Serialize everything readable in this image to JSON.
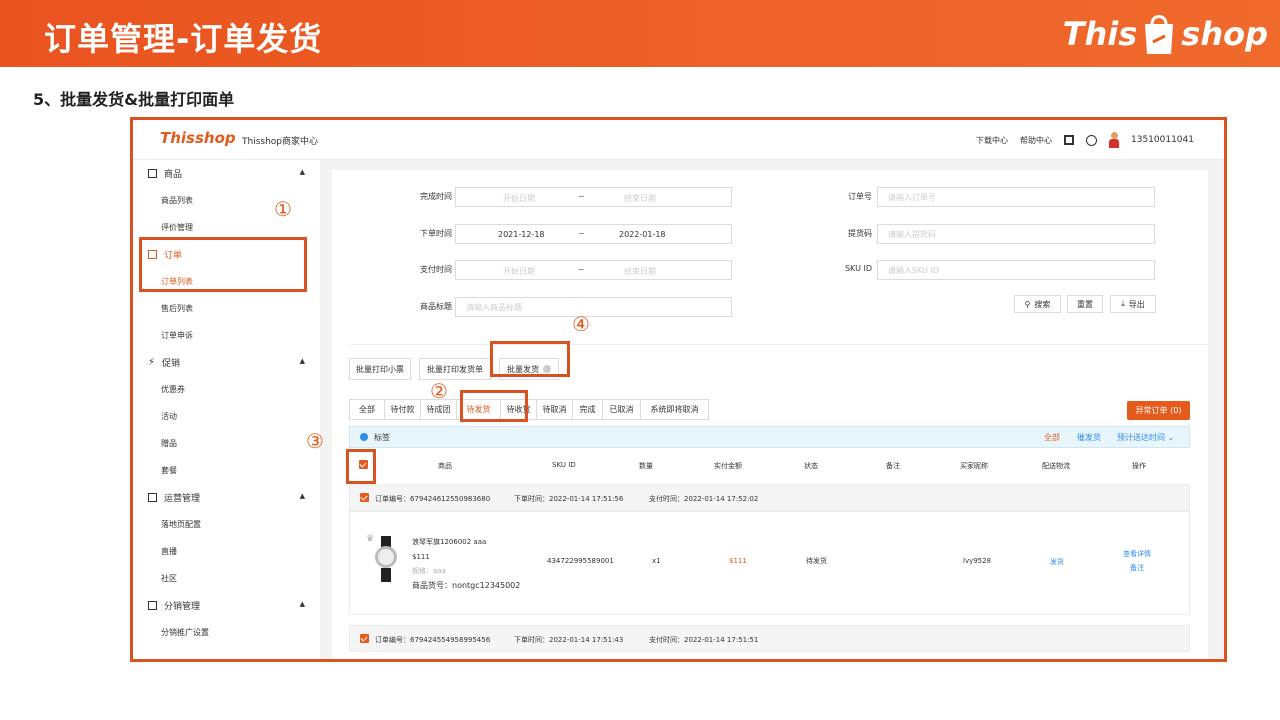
{
  "banner": {
    "title": "订单管理-订单发货",
    "brand_left": "This",
    "brand_right": "shop"
  },
  "subtitle": "5、批量发货&批量打印面单",
  "topbar": {
    "logo_left": "This",
    "logo_right": "shop",
    "center_name": "Thisshop商家中心",
    "download_center": "下载中心",
    "help_center": "帮助中心",
    "phone": "13510011041"
  },
  "sidebar": {
    "goods": "商品",
    "goods_list": "商品列表",
    "review_mgmt": "评价管理",
    "orders": "订单",
    "order_list": "订单列表",
    "after_sale_list": "售后列表",
    "order_appeal": "订单申诉",
    "promotion": "促销",
    "coupons": "优惠券",
    "activity": "活动",
    "gifts": "赠品",
    "bundle": "套餐",
    "operations": "运营管理",
    "landing_config": "落地页配置",
    "live": "直播",
    "community": "社区",
    "distribution": "分销管理",
    "distribution_settings": "分销推广设置"
  },
  "filters": {
    "complete_time_label": "完成时间",
    "complete_start_ph": "开始日期",
    "complete_end_ph": "结束日期",
    "order_time_label": "下单时间",
    "order_start": "2021-12-18",
    "order_end": "2022-01-18",
    "pay_time_label": "支付时间",
    "pay_start_ph": "开始日期",
    "pay_end_ph": "结束日期",
    "product_title_label": "商品标题",
    "product_title_ph": "请输入商品标题",
    "order_no_label": "订单号",
    "order_no_ph": "请输入订单号",
    "pickup_code_label": "提货码",
    "pickup_code_ph": "请输入提货码",
    "sku_label": "SKU ID",
    "sku_ph": "请输入SKU ID",
    "range_sep": "~",
    "search_btn": "搜索",
    "reset_btn": "重置",
    "export_btn": "导出"
  },
  "batch": {
    "print_ticket": "批量打印小票",
    "print_invoice": "批量打印发货单",
    "batch_ship": "批量发货"
  },
  "tabs": [
    "全部",
    "待付款",
    "待成团",
    "待发货",
    "待收货",
    "待取消",
    "完成",
    "已取消",
    "系统即将取消"
  ],
  "abnormal_btn": "异常订单 (0)",
  "tagbar": {
    "label": "标签",
    "all": "全部",
    "urge": "催发货",
    "expected": "预计送达时间"
  },
  "table_headers": [
    "商品",
    "SKU ID",
    "数量",
    "实付金额",
    "状态",
    "备注",
    "买家昵称",
    "配送物流",
    "操作"
  ],
  "orders": [
    {
      "order_no": "订单编号：679424612550983680",
      "order_time": "下单时间：2022-01-14 17:51:56",
      "pay_time": "支付时间：2022-01-14 17:52:02",
      "product_name": "浪琴军旗1206002 aaa",
      "price": "$111",
      "spec": "规格：aaa",
      "goods_no": "商品货号：nontgc12345002",
      "sku_id": "434722995589001",
      "qty": "x1",
      "paid": "$111",
      "status": "待发货",
      "buyer": "lvy9528",
      "logistics": "发货",
      "action_detail": "查看详情",
      "action_note": "备注"
    },
    {
      "order_no": "订单编号：679424554958995456",
      "order_time": "下单时间：2022-01-14 17:51:43",
      "pay_time": "支付时间：2022-01-14 17:51:51"
    }
  ],
  "markers": [
    "①",
    "②",
    "③",
    "④"
  ]
}
